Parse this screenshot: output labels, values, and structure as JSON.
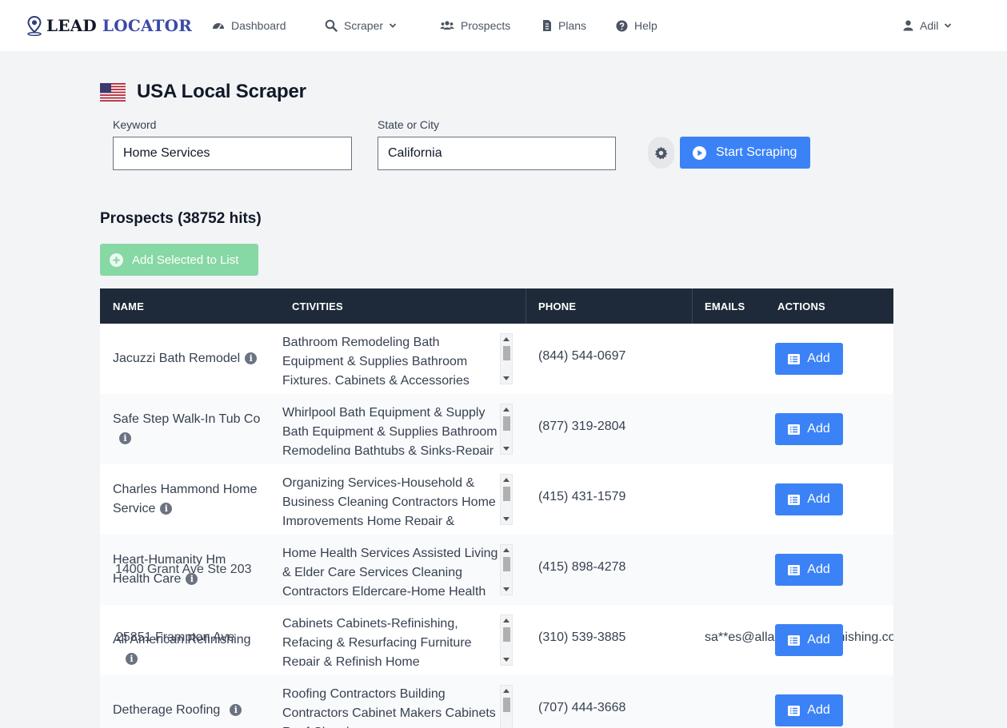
{
  "nav": {
    "logo_part1": "LEAD",
    "logo_part2": "LOCATOR",
    "dashboard": "Dashboard",
    "scraper": "Scraper",
    "prospects": "Prospects",
    "plans": "Plans",
    "help": "Help",
    "user": "Adil"
  },
  "header": {
    "title": "USA Local Scraper"
  },
  "form": {
    "keyword_label": "Keyword",
    "keyword_value": "Home Services",
    "location_label": "State or City",
    "location_value": "California",
    "start_label": "Start Scraping"
  },
  "prospects": {
    "title": "Prospects (38752 hits)",
    "add_selected_label": "Add Selected to List"
  },
  "table": {
    "headers": {
      "name": "NAME",
      "activities": "CTIVITIES",
      "phone": "PHONE",
      "emails": "EMAILS",
      "actions": "ACTIONS"
    },
    "add_label": "Add",
    "rows": [
      {
        "name": "Jacuzzi Bath Remodel",
        "address": "",
        "activities": "Bathroom Remodeling Bath Equipment & Supplies Bathroom Fixtures, Cabinets & Accessories",
        "phone": "(844) 544-0697",
        "email": ""
      },
      {
        "name": "Safe Step Walk-In Tub Co",
        "address": "",
        "activities": "Whirlpool Bath Equipment & Supply Bath Equipment & Supplies Bathroom Remodeling Bathtubs & Sinks-Repair",
        "phone": "(877) 319-2804",
        "email": ""
      },
      {
        "name": "Charles Hammond Home Service",
        "address": "",
        "activities": "Organizing Services-Household & Business Cleaning Contractors Home Improvements Home Repair &",
        "phone": "(415) 431-1579",
        "email": ""
      },
      {
        "name": "Heart-Humanity Hm Health Care",
        "address": "1400 Grant Ave Ste 203",
        "activities": "Home Health Services Assisted Living & Elder Care Services Cleaning Contractors Eldercare-Home Health",
        "phone": "(415) 898-4278",
        "email": ""
      },
      {
        "name": "All American Refinishing",
        "address": "25851 Frampton Ave",
        "activities": "Cabinets Cabinets-Refinishing, Refacing & Resurfacing Furniture Repair & Refinish Home",
        "phone": "(310) 539-3885",
        "email": "sa**es@allamericanrefinishing.com"
      },
      {
        "name": "Detherage Roofing",
        "address": "",
        "activities": "Roofing Contractors Building Contractors Cabinet Makers Cabinets Roof Cleaning",
        "phone": "(707) 444-3668",
        "email": ""
      }
    ]
  }
}
